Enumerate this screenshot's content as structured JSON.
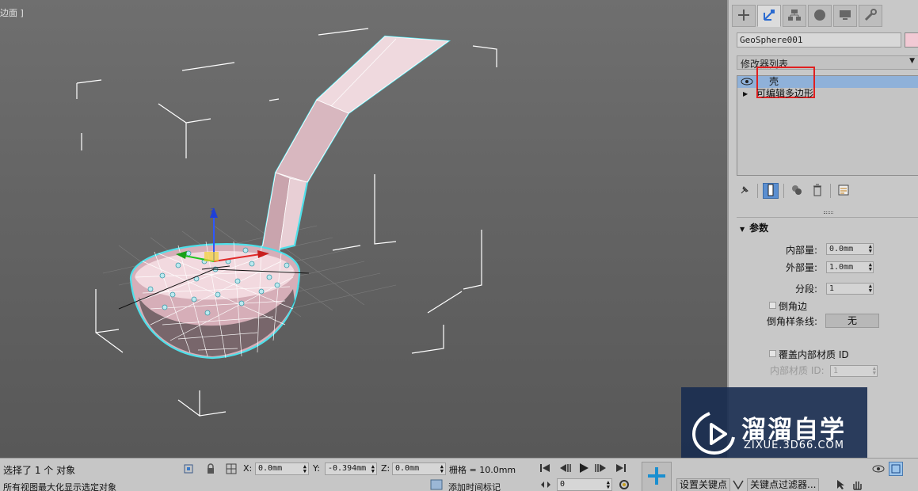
{
  "viewport": {
    "label": "边面 ]"
  },
  "command_panel": {
    "tabs": [
      "create-icon",
      "modify-icon",
      "hierarchy-icon",
      "motion-icon",
      "display-icon",
      "utilities-icon"
    ],
    "object_name": "GeoSphere001",
    "object_color": "#f2c9d4",
    "modifier_list": "修改器列表",
    "stack": [
      {
        "label": "壳",
        "selected": true
      },
      {
        "label": "可编辑多边形",
        "selected": false
      }
    ],
    "params": {
      "title": "参数",
      "inner_amount_label": "内部量:",
      "inner_amount_value": "0.0mm",
      "outer_amount_label": "外部量:",
      "outer_amount_value": "1.0mm",
      "segments_label": "分段:",
      "segments_value": "1",
      "bevel_edges_label": "倒角边",
      "bevel_spline_label": "倒角样条线:",
      "bevel_spline_button": "无",
      "override_inner_mat_label": "覆盖内部材质 ID",
      "inner_mat_id_label": "内部材质 ID:",
      "inner_mat_id_value": "1"
    }
  },
  "watermark": {
    "title": "溜溜自学",
    "subtitle": "ZIXUE.3D66.COM"
  },
  "bottom_bar": {
    "selection_status": "选择了 1 个 对象",
    "prompt": "所有视图最大化显示选定对象",
    "x_label": "X:",
    "x_value": "0.0mm",
    "y_label": "Y:",
    "y_value": "-0.394mm",
    "z_label": "Z:",
    "z_value": "0.0mm",
    "grid_label": "栅格 = 10.0mm",
    "add_time_tag": "添加时间标记",
    "frame_value": "0",
    "set_key": "设置关键点",
    "key_filters": "关键点过滤器..."
  }
}
